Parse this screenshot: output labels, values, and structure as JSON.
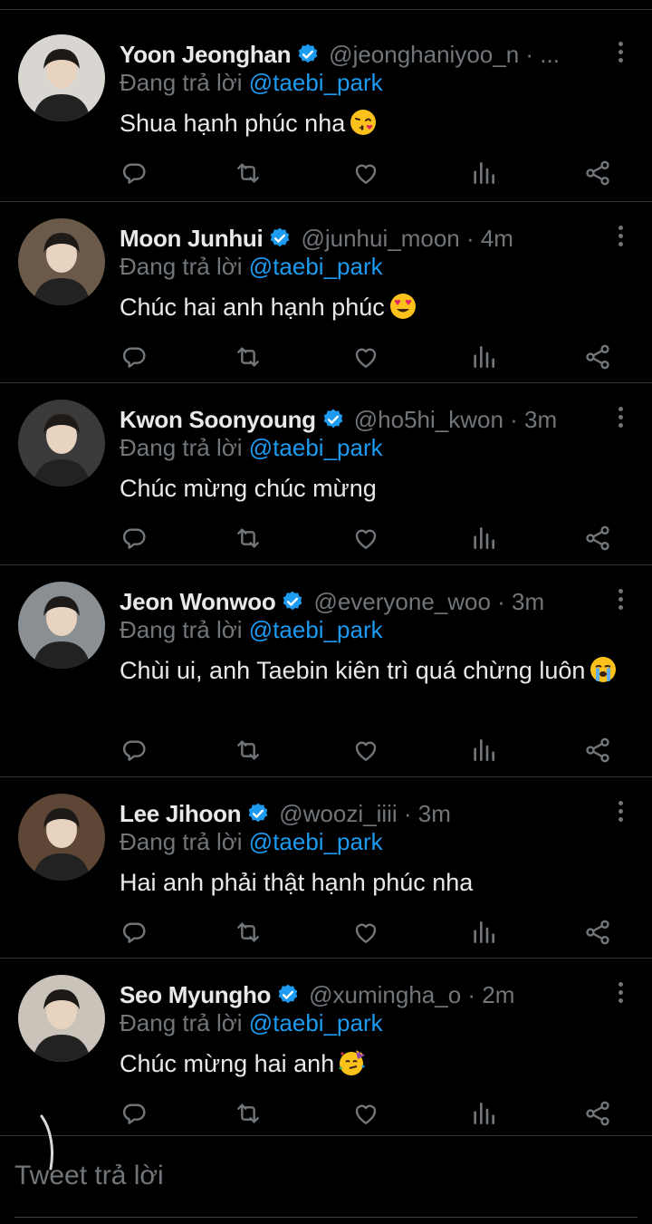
{
  "tweets": [
    {
      "name": "Yoon Jeonghan",
      "handle": "@jeonghaniyoo_n · ...",
      "replying_prefix": "Đang trả lời",
      "replying_to": "@taebi_park",
      "text": "Shua hạnh phúc nha",
      "emoji": "kissing-face-emoji",
      "avatar_bg": "#d9d6d2"
    },
    {
      "name": "Moon Junhui",
      "handle": "@junhui_moon · 4m",
      "replying_prefix": "Đang trả lời",
      "replying_to": "@taebi_park",
      "text": "Chúc hai anh hạnh phúc",
      "emoji": "heart-eyes-emoji",
      "avatar_bg": "#6b5a4a"
    },
    {
      "name": "Kwon Soonyoung",
      "handle": "@ho5hi_kwon · 3m",
      "replying_prefix": "Đang trả lời",
      "replying_to": "@taebi_park",
      "text": "Chúc mừng chúc mừng",
      "emoji": "",
      "avatar_bg": "#3a3a3a"
    },
    {
      "name": "Jeon Wonwoo",
      "handle": "@everyone_woo · 3m",
      "replying_prefix": "Đang trả lời",
      "replying_to": "@taebi_park",
      "text": "Chùi ui, anh Taebin kiên trì quá chừng luôn",
      "emoji": "loudly-crying-emoji",
      "avatar_bg": "#8a8f94"
    },
    {
      "name": "Lee Jihoon",
      "handle": "@woozi_iiii · 3m",
      "replying_prefix": "Đang trả lời",
      "replying_to": "@taebi_park",
      "text": "Hai anh phải thật hạnh phúc nha",
      "emoji": "",
      "avatar_bg": "#5d4636"
    },
    {
      "name": "Seo Myungho",
      "handle": "@xumingha_o · 2m",
      "replying_prefix": "Đang trả lời",
      "replying_to": "@taebi_park",
      "text": "Chúc mừng hai anh",
      "emoji": "partying-face-emoji",
      "avatar_bg": "#c9c3ba"
    }
  ],
  "action_icons": [
    "reply-icon",
    "retweet-icon",
    "like-icon",
    "views-icon",
    "share-icon"
  ],
  "composer": {
    "placeholder": "Tweet trả lời"
  },
  "colors": {
    "background": "#000000",
    "text": "#e7e9ea",
    "muted": "#71767b",
    "accent": "#1d9bf0",
    "divider": "#2f3336"
  }
}
